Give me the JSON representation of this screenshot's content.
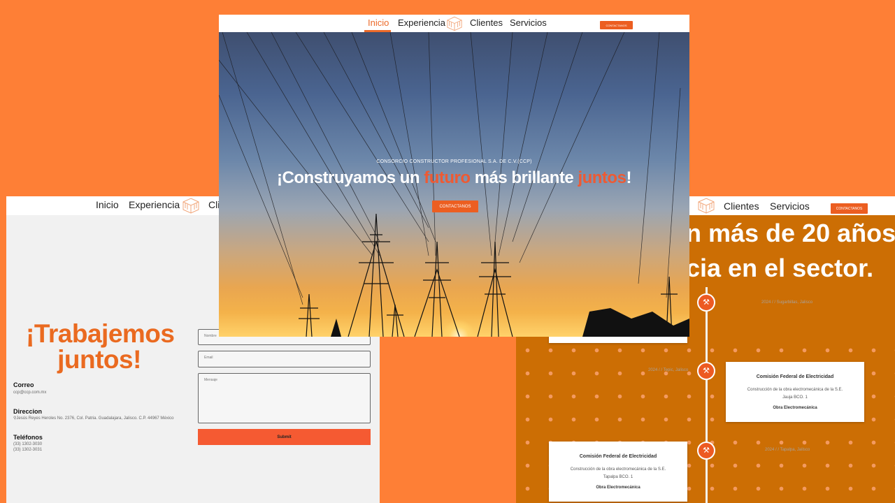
{
  "colors": {
    "background": "#fe7f36",
    "accent": "#ec5e21",
    "timeline_bg": "#cc6e04"
  },
  "hero_page": {
    "nav": {
      "inicio": "Inicio",
      "experiencia": "Experiencia",
      "clientes": "Clientes",
      "servicios": "Servicios",
      "cta": "CONTACTANOS",
      "logo_icon": "ccp-cube-logo-icon"
    },
    "kicker": "CONSORCIO CONSTRUCTOR PROFESIONAL S.A. DE C.V.(CCP)",
    "headline": {
      "p1": "¡Construyamos un ",
      "accent1": "futuro",
      "p2": " más brillante ",
      "accent2": "juntos",
      "p3": "!"
    },
    "button": "CONTACTANOS"
  },
  "contact_page": {
    "nav": {
      "inicio": "Inicio",
      "experiencia": "Experiencia",
      "clientes_partial": "Cli"
    },
    "title_line1": "¡Trabajemos",
    "title_line2": "juntos!",
    "correo_label": "Correo",
    "correo_value": "ccp@ccp.com.mx",
    "direccion_label": "Direccion",
    "direccion_value": "Jesús Reyes Heroles No. 2376, Col. Patria. Guadalajara, Jalisco. C.P. 44967 México",
    "telefonos_label": "Teléfonos",
    "telefono_1": "(33) 1302-3030",
    "telefono_2": "(33) 1302-3031",
    "form": {
      "nombre_placeholder": "Nombre",
      "email_placeholder": "Email",
      "mensaje_placeholder": "Mensaje",
      "submit": "Submit"
    }
  },
  "experience_page": {
    "nav": {
      "clientes": "Clientes",
      "servicios": "Servicios",
      "cta": "CONTACTANOS"
    },
    "headline_line1": "n más de 20 años",
    "headline_line2": "cia en el sector.",
    "timeline": [
      {
        "date": "2024 / / Sugarbillas, Jalisco",
        "icon": "wrench-icon"
      },
      {
        "date": "2024 / / Tepic, Jalisco",
        "icon": "wrench-icon",
        "card": {
          "title": "Comisión Federal de Electricidad",
          "desc_line1": "Construcción de la obra electromecánica de la S.E.",
          "desc_line2": "Jauja BCO. 1",
          "category": "Obra Electromecánica"
        }
      },
      {
        "date": "2024 / / Tapalpa, Jalisco",
        "icon": "wrench-icon",
        "card": {
          "title": "Comisión Federal de Electricidad",
          "desc_line1": "Construcción de la obra electromecánica de la S.E.",
          "desc_line2": "Tapalpa BCO. 1",
          "category": "Obra Electromecánica"
        }
      }
    ]
  }
}
